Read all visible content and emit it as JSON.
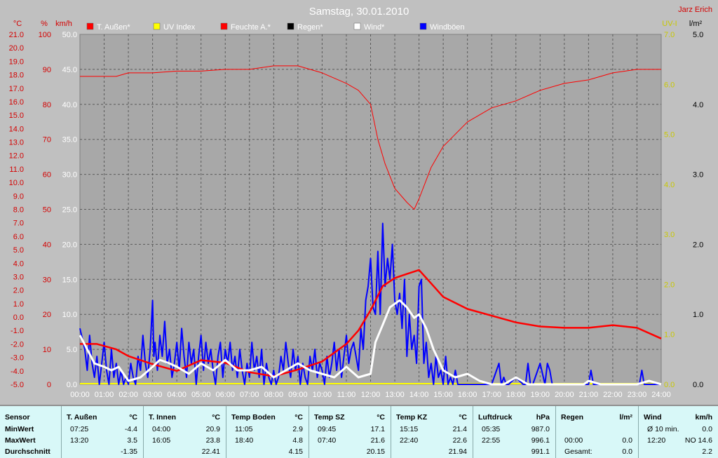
{
  "title": "Samstag, 30.01.2010",
  "author": "Jarz Erich",
  "colors": {
    "temp": "#ff0000",
    "uv": "#ffff00",
    "humidity": "#ff0000",
    "rain": "#000000",
    "wind": "#ffffff",
    "gust": "#0000ff",
    "axis_red": "#d40000",
    "axis_yellow": "#c8c800"
  },
  "axis_units": {
    "temp": "°C",
    "humidity": "%",
    "wind": "km/h",
    "uv": "UV-I",
    "rain": "l/m²"
  },
  "chart_data": {
    "type": "line",
    "x_ticks": [
      "00:00",
      "01:00",
      "02:00",
      "03:00",
      "04:00",
      "05:00",
      "06:00",
      "07:00",
      "08:00",
      "09:00",
      "10:00",
      "11:00",
      "12:00",
      "13:00",
      "14:00",
      "15:00",
      "16:00",
      "17:00",
      "18:00",
      "19:00",
      "20:00",
      "21:00",
      "22:00",
      "23:00",
      "24:00"
    ],
    "axes": {
      "temp": {
        "min": -5.0,
        "max": 21.0,
        "ticks": [
          "21.0",
          "20.0",
          "19.0",
          "18.0",
          "17.0",
          "16.0",
          "15.0",
          "14.0",
          "13.0",
          "12.0",
          "11.0",
          "10.0",
          "9.0",
          "8.0",
          "7.0",
          "6.0",
          "5.0",
          "4.0",
          "3.0",
          "2.0",
          "1.0",
          "0.0",
          "-1.0",
          "-2.0",
          "-3.0",
          "-4.0",
          "-5.0"
        ]
      },
      "humidity": {
        "min": 0,
        "max": 100,
        "ticks": [
          "100",
          "90",
          "80",
          "70",
          "60",
          "50",
          "40",
          "30",
          "20",
          "10",
          "0"
        ]
      },
      "wind": {
        "min": 0,
        "max": 50,
        "ticks": [
          "50.0",
          "45.0",
          "40.0",
          "35.0",
          "30.0",
          "25.0",
          "20.0",
          "15.0",
          "10.0",
          "5.0",
          "0.0"
        ]
      },
      "uv": {
        "min": 0,
        "max": 7,
        "ticks": [
          "7.0",
          "6.0",
          "5.0",
          "4.0",
          "3.0",
          "2.0",
          "1.0",
          "0.0"
        ]
      },
      "rain": {
        "min": 0,
        "max": 5,
        "ticks": [
          "5.0",
          "4.0",
          "3.0",
          "2.0",
          "1.0",
          "0.0"
        ]
      }
    },
    "legend": [
      {
        "name": "T. Außen*",
        "color": "#ff0000"
      },
      {
        "name": "UV Index",
        "color": "#ffff00"
      },
      {
        "name": "Feuchte A.*",
        "color": "#ff0000"
      },
      {
        "name": "Regen*",
        "color": "#000000"
      },
      {
        "name": "Wind*",
        "color": "#ffffff"
      },
      {
        "name": "Windböen",
        "color": "#0000ff"
      }
    ],
    "series": [
      {
        "name": "Feuchte A.*",
        "axis": "humidity",
        "x": [
          0,
          1.5,
          2,
          3,
          4,
          5,
          6,
          7,
          8,
          9,
          10,
          11,
          11.5,
          12,
          12.3,
          12.6,
          13,
          13.5,
          13.8,
          14,
          14.5,
          15,
          16,
          17,
          18,
          19,
          20,
          21,
          22,
          23,
          24
        ],
        "values": [
          88,
          88,
          89,
          89,
          89.5,
          89.5,
          90,
          90,
          91,
          91,
          89,
          86,
          84,
          80,
          70,
          63,
          56,
          52,
          50,
          53,
          62,
          68,
          75,
          79,
          81,
          84,
          86,
          87,
          89,
          90,
          90
        ]
      },
      {
        "name": "T. Außen*",
        "axis": "temp",
        "x": [
          0,
          0.7,
          1.5,
          2,
          3,
          4,
          5,
          6,
          7,
          8,
          9,
          10,
          11,
          11.5,
          12,
          12.5,
          13,
          13.5,
          14,
          14.5,
          15,
          16,
          17,
          18,
          19,
          20,
          21,
          22,
          23,
          24
        ],
        "values": [
          -2.0,
          -2.0,
          -2.4,
          -2.9,
          -3.5,
          -4.0,
          -3.2,
          -3.4,
          -4.1,
          -4.4,
          -3.9,
          -3.3,
          -2.0,
          -1.0,
          0.5,
          2.3,
          2.9,
          3.2,
          3.5,
          2.5,
          1.5,
          0.6,
          0.1,
          -0.4,
          -0.7,
          -0.8,
          -0.8,
          -0.6,
          -0.8,
          -1.6
        ]
      },
      {
        "name": "Wind*",
        "axis": "wind",
        "x": [
          0,
          0.3,
          0.6,
          1,
          1.3,
          1.6,
          2,
          2.5,
          3,
          3.3,
          3.7,
          4,
          4.5,
          5,
          5.5,
          6,
          6.5,
          7,
          7.5,
          8,
          8.5,
          9,
          9.5,
          10,
          10.5,
          11,
          11.5,
          12,
          12.2,
          12.5,
          12.8,
          13,
          13.2,
          13.5,
          13.8,
          14,
          14.3,
          14.6,
          15,
          15.5,
          16,
          16.5,
          17,
          17.5,
          18,
          18.5,
          19,
          20,
          20.8,
          21,
          21.5,
          22,
          22.5,
          23,
          23.5,
          24
        ],
        "values": [
          7,
          5,
          3,
          2.5,
          2,
          2.5,
          0.5,
          1,
          2.5,
          3.5,
          3,
          2.5,
          1.5,
          3,
          2,
          3.5,
          2,
          2,
          2.5,
          1,
          2,
          3,
          2,
          1.5,
          1,
          2.5,
          1,
          1.5,
          6,
          8.5,
          11,
          11.5,
          12,
          11,
          9.5,
          10,
          8,
          5,
          2,
          1,
          1.5,
          0.5,
          0,
          0,
          1,
          0,
          0,
          0,
          0,
          0.5,
          0,
          0,
          0,
          0,
          0.5,
          0
        ]
      },
      {
        "name": "Windböen",
        "axis": "wind",
        "x": [
          0,
          0.2,
          0.3,
          0.4,
          0.5,
          0.6,
          0.7,
          0.8,
          0.9,
          1,
          1.1,
          1.2,
          1.3,
          1.4,
          1.5,
          1.6,
          1.7,
          1.8,
          1.9,
          2,
          2.1,
          2.2,
          2.3,
          2.4,
          2.5,
          2.6,
          2.7,
          2.8,
          2.9,
          3,
          3.05,
          3.1,
          3.2,
          3.3,
          3.4,
          3.5,
          3.6,
          3.7,
          3.8,
          3.9,
          4,
          4.1,
          4.2,
          4.3,
          4.4,
          4.5,
          4.6,
          4.7,
          4.8,
          4.9,
          5,
          5.1,
          5.2,
          5.3,
          5.4,
          5.5,
          5.6,
          5.7,
          5.8,
          5.9,
          6,
          6.1,
          6.2,
          6.3,
          6.4,
          6.5,
          6.6,
          6.7,
          6.8,
          6.9,
          7,
          7.1,
          7.2,
          7.3,
          7.4,
          7.5,
          7.6,
          7.7,
          7.8,
          7.9,
          8,
          8.1,
          8.2,
          8.3,
          8.4,
          8.5,
          8.6,
          8.7,
          8.8,
          8.9,
          9,
          9.1,
          9.2,
          9.3,
          9.4,
          9.5,
          9.6,
          9.7,
          9.8,
          9.9,
          10,
          10.1,
          10.2,
          10.3,
          10.4,
          10.5,
          10.6,
          10.7,
          10.8,
          10.9,
          11,
          11.1,
          11.2,
          11.3,
          11.4,
          11.5,
          11.6,
          11.7,
          11.8,
          11.9,
          12,
          12.1,
          12.2,
          12.3,
          12.4,
          12.5,
          12.6,
          12.7,
          12.8,
          12.9,
          13,
          13.1,
          13.2,
          13.3,
          13.4,
          13.5,
          13.6,
          13.7,
          13.8,
          13.9,
          14,
          14.1,
          14.2,
          14.3,
          14.4,
          14.5,
          14.6,
          14.7,
          14.8,
          14.9,
          15,
          15.1,
          15.2,
          15.3,
          15.4,
          15.5,
          15.6,
          15.7,
          15.8,
          15.9,
          16,
          16.5,
          17,
          17.3,
          17.4,
          17.5,
          17.6,
          17.7,
          18,
          18.3,
          18.4,
          18.5,
          18.6,
          18.7,
          19,
          19.2,
          19.3,
          19.4,
          19.5,
          19.6,
          20,
          20.5,
          21,
          21.1,
          21.2,
          21.3,
          21.4,
          22,
          22.5,
          23,
          23.1,
          23.2,
          23.3,
          23.4,
          24
        ],
        "values": [
          8,
          5,
          2,
          7,
          3,
          1,
          4,
          0,
          3,
          6,
          2,
          0,
          5,
          1,
          3,
          0,
          2,
          0,
          1,
          0,
          3,
          1,
          0,
          4,
          2,
          7,
          3,
          1,
          5,
          12,
          4,
          6,
          2,
          7,
          4,
          9,
          3,
          5,
          1,
          3,
          6,
          2,
          8,
          4,
          1,
          6,
          3,
          5,
          0,
          4,
          7,
          2,
          6,
          3,
          5,
          2,
          0,
          4,
          6,
          1,
          5,
          3,
          6,
          2,
          4,
          1,
          5,
          2,
          0,
          3,
          1,
          6,
          2,
          4,
          1,
          5,
          0,
          3,
          1,
          0,
          2,
          0,
          1,
          4,
          2,
          6,
          3,
          1,
          5,
          2,
          4,
          0,
          3,
          1,
          0,
          4,
          2,
          5,
          1,
          3,
          2,
          0,
          4,
          1,
          3,
          6,
          2,
          5,
          1,
          4,
          7,
          3,
          5,
          6,
          4,
          2,
          8,
          5,
          12,
          14,
          18,
          11,
          10,
          19,
          10,
          23,
          14,
          18,
          15,
          20,
          12,
          10,
          13,
          8,
          15,
          4,
          10,
          5,
          7,
          3,
          14,
          15,
          3,
          6,
          1,
          3,
          0,
          4,
          1,
          2,
          0,
          4,
          0,
          1,
          0,
          2,
          0,
          0,
          0,
          0,
          0,
          0,
          0,
          3,
          0,
          1,
          0,
          0,
          1,
          0,
          0,
          3,
          0,
          0,
          3,
          0,
          3,
          2,
          0,
          0,
          0,
          0,
          0,
          2,
          0,
          0,
          0,
          0,
          0,
          0,
          0,
          2,
          0,
          0,
          0
        ]
      }
    ]
  },
  "stats": [
    {
      "header": "Sensor",
      "unit": "",
      "rows": [
        {
          "time": "MinWert",
          "value": ""
        },
        {
          "time": "MaxWert",
          "value": ""
        },
        {
          "time": "Durchschnitt",
          "value": ""
        }
      ]
    },
    {
      "header": "T. Außen",
      "unit": "°C",
      "rows": [
        {
          "time": "07:25",
          "value": "-4.4"
        },
        {
          "time": "13:20",
          "value": "3.5"
        },
        {
          "time": "",
          "value": "-1.35"
        }
      ]
    },
    {
      "header": "T. Innen",
      "unit": "°C",
      "rows": [
        {
          "time": "04:00",
          "value": "20.9"
        },
        {
          "time": "16:05",
          "value": "23.8"
        },
        {
          "time": "",
          "value": "22.41"
        }
      ]
    },
    {
      "header": "Temp Boden",
      "unit": "°C",
      "rows": [
        {
          "time": "11:05",
          "value": "2.9"
        },
        {
          "time": "18:40",
          "value": "4.8"
        },
        {
          "time": "",
          "value": "4.15"
        }
      ]
    },
    {
      "header": "Temp SZ",
      "unit": "°C",
      "rows": [
        {
          "time": "09:45",
          "value": "17.1"
        },
        {
          "time": "07:40",
          "value": "21.6"
        },
        {
          "time": "",
          "value": "20.15"
        }
      ]
    },
    {
      "header": "Temp KZ",
      "unit": "°C",
      "rows": [
        {
          "time": "15:15",
          "value": "21.4"
        },
        {
          "time": "22:40",
          "value": "22.6"
        },
        {
          "time": "",
          "value": "21.94"
        }
      ]
    },
    {
      "header": "Luftdruck",
      "unit": "hPa",
      "rows": [
        {
          "time": "05:35",
          "value": "987.0"
        },
        {
          "time": "22:55",
          "value": "996.1"
        },
        {
          "time": "",
          "value": "991.1"
        }
      ]
    },
    {
      "header": "Regen",
      "unit": "l/m²",
      "rows": [
        {
          "time": "",
          "value": ""
        },
        {
          "time": "00:00",
          "value": "0.0"
        },
        {
          "time": "Gesamt:",
          "value": "0.0"
        }
      ]
    },
    {
      "header": "Wind",
      "unit": "km/h",
      "rows": [
        {
          "time": "Ø 10 min.",
          "value": "0.0"
        },
        {
          "time": "12:20",
          "value": "NO 14.6"
        },
        {
          "time": "",
          "value": "2.2"
        }
      ]
    }
  ]
}
